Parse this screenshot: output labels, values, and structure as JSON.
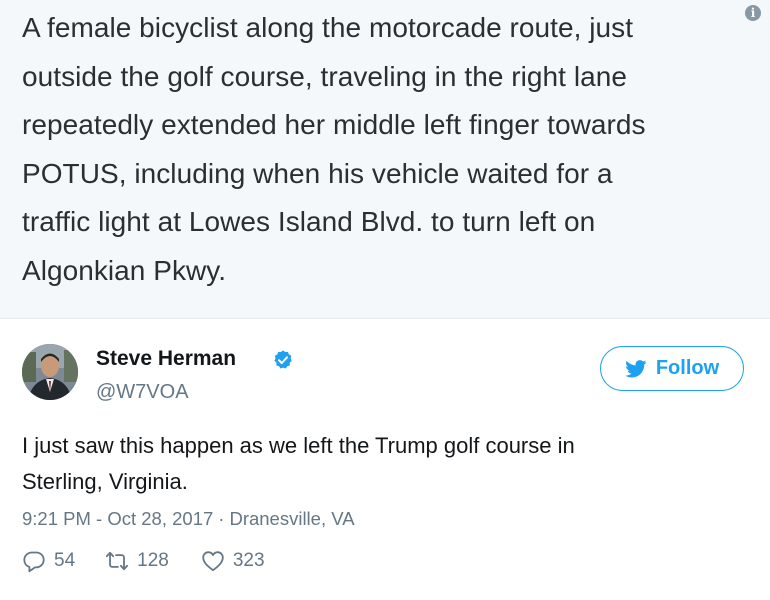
{
  "quoted": {
    "lines": [
      "A female bicyclist along the motorcade route, just",
      "outside the golf course, traveling in the right lane",
      "repeatedly extended her middle left finger towards",
      "POTUS, including when his vehicle waited for a",
      "traffic light at Lowes Island Blvd. to turn left on",
      "Algonkian Pkwy."
    ],
    "info_icon": "info-icon",
    "info_glyph": "i"
  },
  "tweet": {
    "display_name": "Steve Herman",
    "verified_icon": "verified-badge-icon",
    "handle": "@W7VOA",
    "follow_label": "Follow",
    "text_lines": [
      "I just saw this happen as we left the Trump golf course in",
      "Sterling, Virginia."
    ],
    "timestamp": "9:21 PM - Oct 28, 2017",
    "meta_separator": "·",
    "location": "Dranesville, VA",
    "replies": "54",
    "retweets": "128",
    "likes": "323"
  },
  "colors": {
    "accent": "#1da1f2",
    "muted": "#657786",
    "quote_background": "#f5f8fa"
  }
}
